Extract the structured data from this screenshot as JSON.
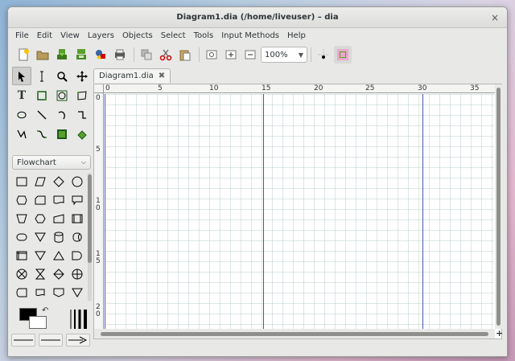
{
  "window": {
    "title": "Diagram1.dia (/home/liveuser) – dia",
    "close_glyph": "×"
  },
  "menu": [
    "File",
    "Edit",
    "View",
    "Layers",
    "Objects",
    "Select",
    "Tools",
    "Input Methods",
    "Help"
  ],
  "toolbar": {
    "zoom_value": "100%",
    "buttons": [
      "new-icon",
      "open-icon",
      "save-icon",
      "save-as-icon",
      "export-icon",
      "print-icon",
      "group-icon",
      "cut-icon",
      "paste-icon",
      "zoom-fit-icon",
      "zoom-in-icon",
      "zoom-out-icon",
      "snap-grid-icon",
      "guide-icon"
    ]
  },
  "toolbox": {
    "tools": [
      "pointer-icon",
      "text-cursor-icon",
      "magnify-icon",
      "move-icon",
      "text-tool-icon",
      "box-icon",
      "ellipse-icon",
      "polygon-icon",
      "beziergon-icon",
      "line-icon",
      "arc-icon",
      "zigzag-icon",
      "polyline-icon",
      "bezier-icon",
      "image-icon",
      "outline-icon"
    ],
    "sheet_name": "Flowchart",
    "sheet_arrow": "⌵"
  },
  "tabs": [
    {
      "label": "Diagram1.dia",
      "close_glyph": "✖"
    }
  ],
  "ruler": {
    "h_labels": [
      "0",
      "5",
      "10",
      "15",
      "20",
      "25",
      "30",
      "35"
    ],
    "v_labels": [
      "0",
      "5",
      "1\n0",
      "1\n5",
      "2\n0"
    ]
  },
  "colors": {
    "foreground": "#000000",
    "background": "#ffffff",
    "page_break": "#4a55b5",
    "grid": "#b4c8c8"
  }
}
